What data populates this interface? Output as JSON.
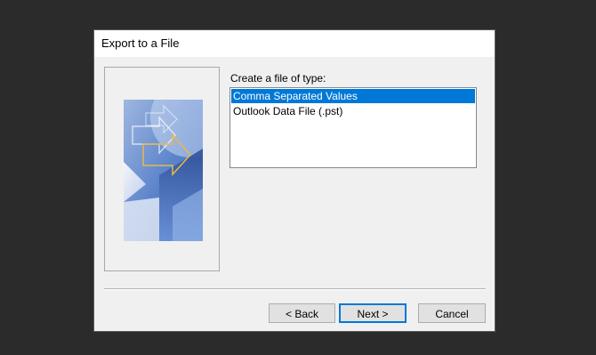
{
  "dialog": {
    "title": "Export to a File"
  },
  "main": {
    "type_label": "Create a file of type:",
    "file_types": [
      {
        "label": "Comma Separated Values",
        "selected": true
      },
      {
        "label": "Outlook Data File (.pst)",
        "selected": false
      }
    ]
  },
  "buttons": {
    "back_label": "< Back",
    "next_label": "Next >",
    "cancel_label": "Cancel"
  },
  "colors": {
    "selection": "#0078d7",
    "art_blue": "#3b63b0",
    "art_arrow": "#e8b84a"
  },
  "icons": {
    "wizard_art": "export-wizard-art"
  }
}
